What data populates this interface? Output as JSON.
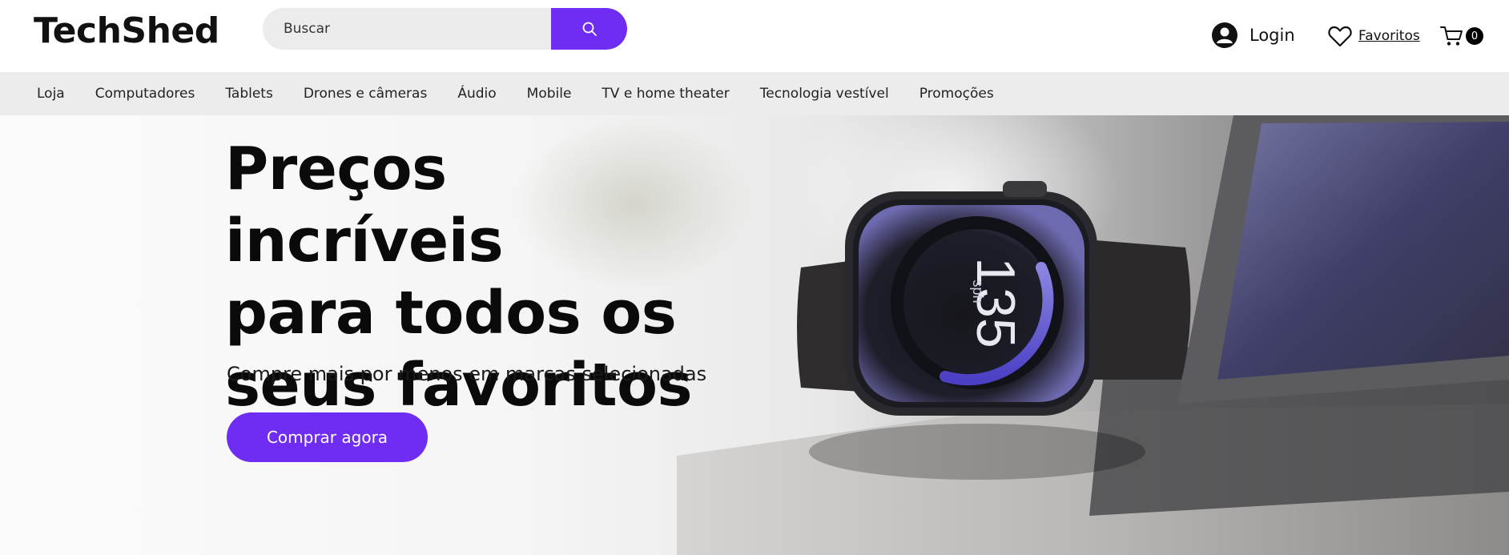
{
  "header": {
    "logo": "TechShed",
    "search": {
      "placeholder": "Buscar",
      "icon": "search-icon"
    },
    "login_label": "Login",
    "favorites_label": "Favoritos",
    "cart_count": "0"
  },
  "nav": {
    "items": [
      {
        "label": "Loja"
      },
      {
        "label": "Computadores"
      },
      {
        "label": "Tablets"
      },
      {
        "label": "Drones e câmeras"
      },
      {
        "label": "Áudio"
      },
      {
        "label": "Mobile"
      },
      {
        "label": "TV e home theater"
      },
      {
        "label": "Tecnologia vestível"
      },
      {
        "label": "Promoções"
      }
    ]
  },
  "hero": {
    "title_lines": [
      "Preços incríveis",
      "para todos os",
      "seus favoritos"
    ],
    "subtitle": "Compre mais por menos em marcas selecionadas",
    "cta_label": "Comprar agora",
    "watch_value": "135",
    "watch_unit": "sph"
  },
  "colors": {
    "accent": "#6f2cf3",
    "nav_bg": "#ececec",
    "search_bg": "#ececec"
  }
}
